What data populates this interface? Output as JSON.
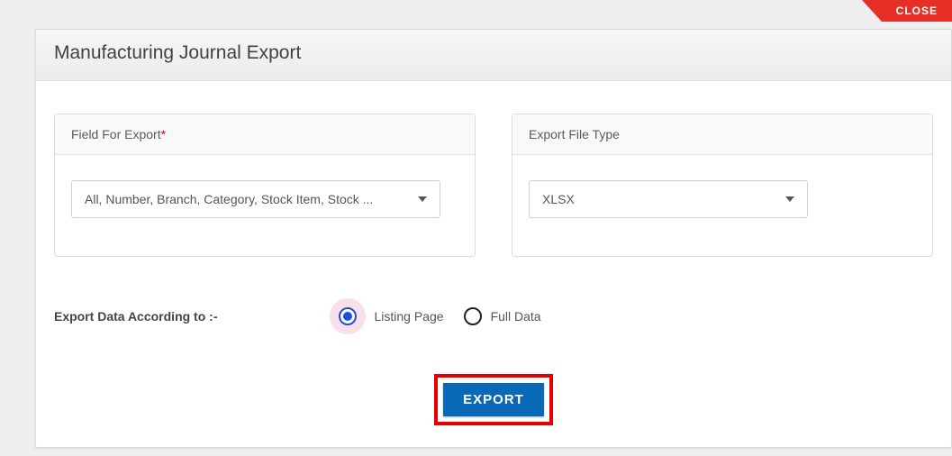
{
  "close_label": "CLOSE",
  "dialog": {
    "title": "Manufacturing Journal Export"
  },
  "field_for_export": {
    "label": "Field For Export",
    "required_mark": "*",
    "selected_display": "All, Number, Branch, Category, Stock Item, Stock ..."
  },
  "export_file_type": {
    "label": "Export File Type",
    "selected": "XLSX"
  },
  "data_scope": {
    "prompt": "Export Data According to :-",
    "options": [
      {
        "key": "listing",
        "label": "Listing Page",
        "checked": true
      },
      {
        "key": "full",
        "label": "Full Data",
        "checked": false
      }
    ]
  },
  "actions": {
    "export_label": "EXPORT"
  }
}
